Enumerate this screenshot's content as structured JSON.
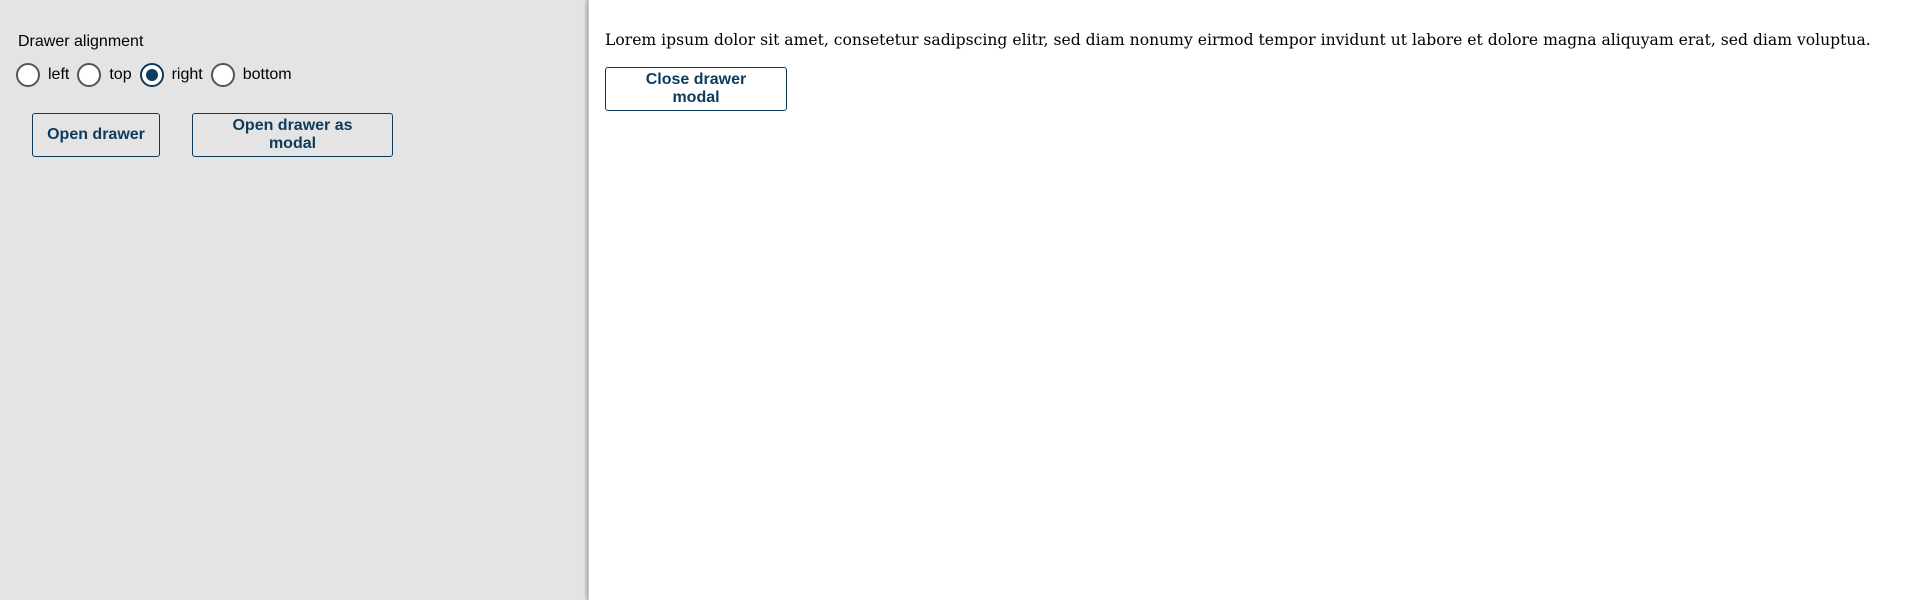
{
  "controls": {
    "group_label": "Drawer alignment",
    "options": [
      {
        "label": "left",
        "checked": false
      },
      {
        "label": "top",
        "checked": false
      },
      {
        "label": "right",
        "checked": true
      },
      {
        "label": "bottom",
        "checked": false
      }
    ],
    "open_drawer_label": "Open drawer",
    "open_modal_label": "Open drawer as modal"
  },
  "drawer": {
    "text": "Lorem ipsum dolor sit amet, consetetur sadipscing elitr, sed diam nonumy eirmod tempor invidunt ut labore et dolore magna aliquyam erat, sed diam voluptua.",
    "close_label": "Close drawer modal",
    "alignment": "right"
  },
  "colors": {
    "accent": "#0d3b5c",
    "page_background": "#e4e4e4",
    "drawer_background": "#ffffff"
  }
}
